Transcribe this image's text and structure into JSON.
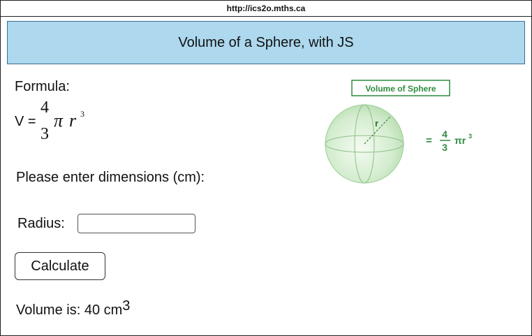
{
  "url": "http://ics2o.mths.ca",
  "banner": {
    "title": "Volume of a Sphere, with JS"
  },
  "formula": {
    "label": "Formula:",
    "lhs": "V =",
    "numerator": "4",
    "denominator": "3",
    "pi": "π",
    "r": "r",
    "exponent": "3"
  },
  "prompt": "Please enter dimensions (cm):",
  "radius": {
    "label": "Radius:",
    "value": "",
    "placeholder": ""
  },
  "calculate_button": "Calculate",
  "result": {
    "text": "Volume is: 40 cm",
    "unit_exponent": "3"
  },
  "illustration": {
    "title": "Volume of Sphere",
    "radius_label": "r",
    "formula_eq": "=",
    "formula_num": "4",
    "formula_den": "3",
    "formula_pi_r": "πr",
    "formula_exp": "3"
  },
  "colors": {
    "banner": "#add8ee",
    "accent_green": "#2e8b3e",
    "sphere": "#c8e6c0"
  }
}
